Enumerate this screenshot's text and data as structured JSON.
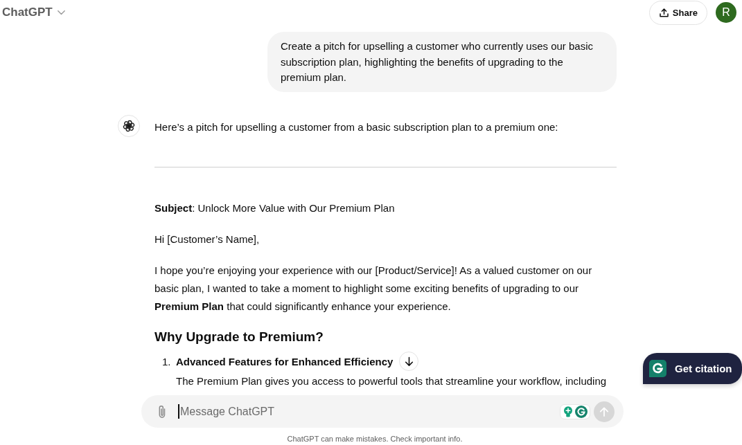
{
  "header": {
    "model_selector": {
      "label": "ChatGPT"
    },
    "share_button": {
      "label": "Share"
    },
    "avatar": {
      "initial": "R"
    }
  },
  "conversation": {
    "user_message": "Create a pitch for upselling a customer who currently uses our basic subscription plan, highlighting the benefits of upgrading to the premium plan.",
    "assistant_message": {
      "intro": "Here’s a pitch for upselling a customer from a basic subscription plan to a premium one:",
      "blocks": [
        {
          "kind": "rule"
        },
        {
          "kind": "paragraph",
          "text": "**Subject**: Unlock More Value with Our Premium Plan"
        },
        {
          "kind": "paragraph",
          "text": "Hi [Customer’s Name],"
        },
        {
          "kind": "paragraph",
          "text": "I hope you’re enjoying your experience with our [Product/Service]! As a valued customer on our basic plan, I wanted to take a moment to highlight some exciting benefits of upgrading to our **Premium Plan** that could significantly enhance your experience."
        },
        {
          "kind": "heading",
          "text": "Why Upgrade to Premium?"
        },
        {
          "kind": "numbered_list",
          "items": [
            {
              "number": "1.",
              "title": "Advanced Features for Enhanced Efficiency",
              "text": "The Premium Plan gives you access to powerful tools that streamline your workflow, including"
            }
          ]
        }
      ]
    }
  },
  "citation_button": {
    "label": "Get citation"
  },
  "composer": {
    "placeholder": "Message ChatGPT",
    "focused": true,
    "send_button": {
      "disabled": true
    }
  },
  "disclaimer": "ChatGPT can make mistakes. Check important info."
}
